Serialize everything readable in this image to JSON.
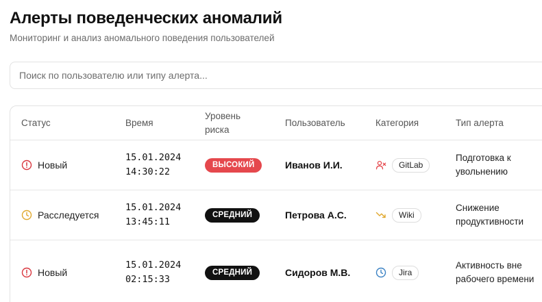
{
  "header": {
    "title": "Алерты поведенческих аномалий",
    "subtitle": "Мониторинг и анализ аномального поведения пользователей"
  },
  "search": {
    "placeholder": "Поиск по пользователю или типу алерта..."
  },
  "table": {
    "columns": {
      "status": "Статус",
      "time": "Время",
      "risk": "Уровень риска",
      "user": "Пользователь",
      "category": "Категория",
      "alert_type": "Тип алерта"
    },
    "rows": [
      {
        "status": "Новый",
        "status_icon": "alert-circle-icon",
        "status_color": "#d9363e",
        "date": "15.01.2024",
        "time": "14:30:22",
        "risk": "ВЫСОКИЙ",
        "risk_color": "#e5484d",
        "user": "Иванов И.И.",
        "category_icon": "user-x-icon",
        "category_icon_color": "#e5484d",
        "category": "GitLab",
        "alert_type": "Подготовка к увольнению"
      },
      {
        "status": "Расследуется",
        "status_icon": "clock-icon",
        "status_color": "#e0a82e",
        "date": "15.01.2024",
        "time": "13:45:11",
        "risk": "СРЕДНИЙ",
        "risk_color": "#111111",
        "user": "Петрова А.С.",
        "category_icon": "trending-down-icon",
        "category_icon_color": "#e0a82e",
        "category": "Wiki",
        "alert_type": "Снижение продуктивности"
      },
      {
        "status": "Новый",
        "status_icon": "alert-circle-icon",
        "status_color": "#d9363e",
        "date": "15.01.2024",
        "time": "02:15:33",
        "risk": "СРЕДНИЙ",
        "risk_color": "#111111",
        "user": "Сидоров М.В.",
        "category_icon": "clock-icon",
        "category_icon_color": "#3b82c4",
        "category": "Jira",
        "alert_type": "Активность вне рабочего времени"
      }
    ]
  }
}
